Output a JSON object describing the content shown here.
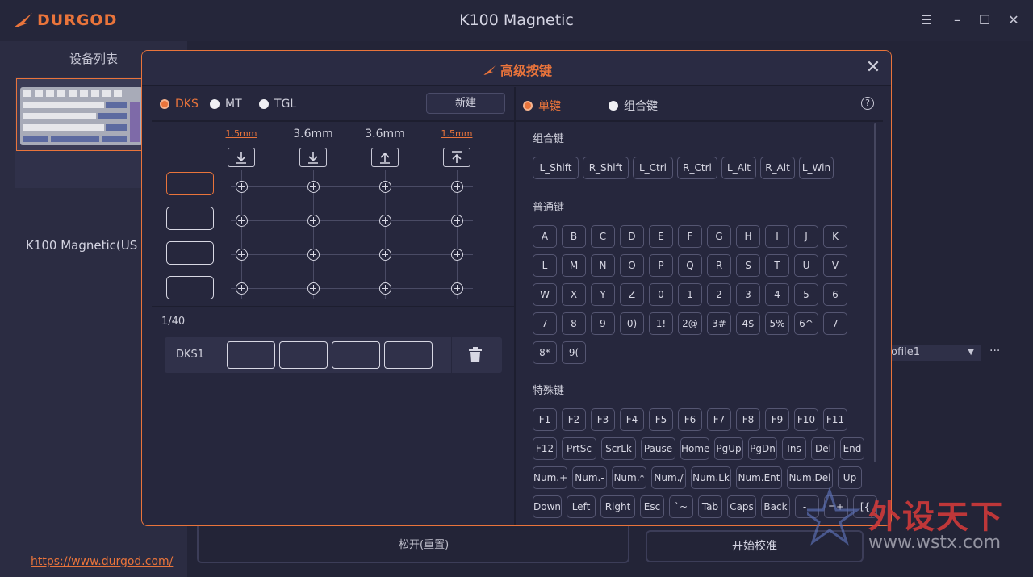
{
  "app": {
    "brand": "DURGOD",
    "title": "K100 Magnetic",
    "brand_color": "#e9743b"
  },
  "sidebar": {
    "title": "设备列表",
    "device_name": "K100 Magnetic(US",
    "link": "https://www.durgod.com/"
  },
  "background": {
    "profile": "ofile1",
    "more": "···",
    "release_label": "松开(重置)",
    "calibrate_label": "开始校准"
  },
  "modal": {
    "title": "高级按键",
    "modes": [
      "DKS",
      "MT",
      "TGL"
    ],
    "active_mode": "DKS",
    "new_label": "新建",
    "columns": [
      {
        "label": "1.5mm",
        "highlight": true,
        "icon": "press-bottom-icon"
      },
      {
        "label": "3.6mm",
        "highlight": false,
        "icon": "press-down-icon"
      },
      {
        "label": "3.6mm",
        "highlight": false,
        "icon": "release-up-icon"
      },
      {
        "label": "1.5mm",
        "highlight": true,
        "icon": "release-top-icon"
      }
    ],
    "count": "1/40",
    "dks_entry": "DKS1",
    "key_types": [
      "单键",
      "组合键"
    ],
    "active_key_type": "单键",
    "help": "?",
    "sections": {
      "combo": {
        "title": "组合键",
        "keys": [
          "L_Shift",
          "R_Shift",
          "L_Ctrl",
          "R_Ctrl",
          "L_Alt",
          "R_Alt",
          "L_Win"
        ]
      },
      "normal": {
        "title": "普通键",
        "rows": [
          [
            "A",
            "B",
            "C",
            "D",
            "E",
            "F",
            "G",
            "H",
            "I",
            "J",
            "K"
          ],
          [
            "L",
            "M",
            "N",
            "O",
            "P",
            "Q",
            "R",
            "S",
            "T",
            "U",
            "V"
          ],
          [
            "W",
            "X",
            "Y",
            "Z",
            "0",
            "1",
            "2",
            "3",
            "4",
            "5",
            "6"
          ],
          [
            "7",
            "8",
            "9",
            "0)",
            "1!",
            "2@",
            "3#",
            "4$",
            "5%",
            "6^",
            "7"
          ],
          [
            "8*",
            "9("
          ]
        ]
      },
      "special": {
        "title": "特殊键",
        "rows": [
          [
            "F1",
            "F2",
            "F3",
            "F4",
            "F5",
            "F6",
            "F7",
            "F8",
            "F9",
            "F10",
            "F11"
          ],
          [
            "F12",
            "PrtSc",
            "ScrLk",
            "Pause",
            "Home",
            "PgUp",
            "PgDn",
            "Ins",
            "Del",
            "End"
          ],
          [
            "Num.+",
            "Num.-",
            "Num.*",
            "Num./",
            "Num.Lk",
            "Num.Ent",
            "Num.Del",
            "Up"
          ],
          [
            "Down",
            "Left",
            "Right",
            "Esc",
            "`~",
            "Tab",
            "Caps",
            "Back",
            "-_",
            "=+",
            "[{"
          ]
        ]
      }
    }
  },
  "watermark": {
    "cn": "外设天下",
    "url": "www.wstx.com"
  }
}
